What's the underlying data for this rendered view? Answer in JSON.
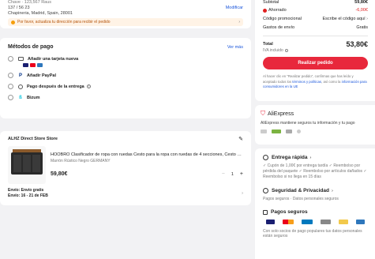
{
  "address": {
    "line1": "Chave · 123,567 Raus",
    "line2": "137 / 56 23",
    "line3": "Chapineria, Madrid, Spain, 28001",
    "modify_label": "Modificar",
    "warning": "Por favor, actualiza tu dirección para recibir el pedido"
  },
  "payment": {
    "title": "Métodos de pago",
    "see_more": "Ver más",
    "methods": [
      {
        "label": "Añadir una tarjeta nueva",
        "icon": "credit-card-icon"
      },
      {
        "label": "Añadir PayPal",
        "icon": "paypal-icon"
      },
      {
        "label": "Pago después de la entrega",
        "icon": "clock-icon"
      },
      {
        "label": "Bizum",
        "icon": "bizum-icon"
      }
    ]
  },
  "store": {
    "name": "ALHZ Direct Store Store",
    "product_title": "HOOBRO Clasificador de ropa con ruedas Cesto para la ropa con ruedas de 4 secciones, Cesto para l",
    "variant": "Marrón Rústico Negro GERMANY",
    "price": "59,80€",
    "quantity": "1",
    "shipping_free": "Envío: Envío gratis",
    "shipping_date": "Envío: 16 - 21 de FEB"
  },
  "summary": {
    "subtotal_label": "Subtotal",
    "subtotal_value": "59,80€",
    "saved_label": "Ahorrado",
    "saved_value": "-6,00€",
    "promo_label": "Código promocional",
    "promo_value": "Escribe el código aquí",
    "shipping_label": "Gastos de envío",
    "shipping_value": "Gratis",
    "total_label": "Total",
    "total_value": "53,80€",
    "vat_label": "IVA incluido",
    "order_button": "Realizar pedido",
    "legal_prefix": "Al hacer clic en \"Realizar pedido\", confirmas que has leído y aceptado todos los",
    "legal_link1": "términos y políticas",
    "legal_mid": ", así como la",
    "legal_link2": "información para consumidores en la UE"
  },
  "aliexpress": {
    "brand": "AliExpress",
    "tagline": "AliExpress mantiene seguros tu información y tu pago"
  },
  "delivery": {
    "title": "Entrega rápida",
    "items": [
      "Cupón de 1,00€ por entrega tardía",
      "Reembolso por pérdida del paquete",
      "Reembolso por artículos dañados",
      "Reembolso si no llega en 15 días"
    ]
  },
  "security": {
    "title": "Seguridad & Privacidad",
    "items": [
      "Pagos seguros",
      "Datos personales seguros"
    ]
  },
  "secure_payments": {
    "title": "Pagos seguros",
    "logos": [
      "VISA",
      "MC",
      "Diners",
      "Apple Pay",
      "Bizum",
      "AMEX"
    ],
    "footer": "Con solo socios de pago populares tus datos personales están seguros"
  },
  "colors": {
    "accent_red": "#e8283c",
    "link_blue": "#1a56db",
    "background": "#f2f2f4"
  }
}
